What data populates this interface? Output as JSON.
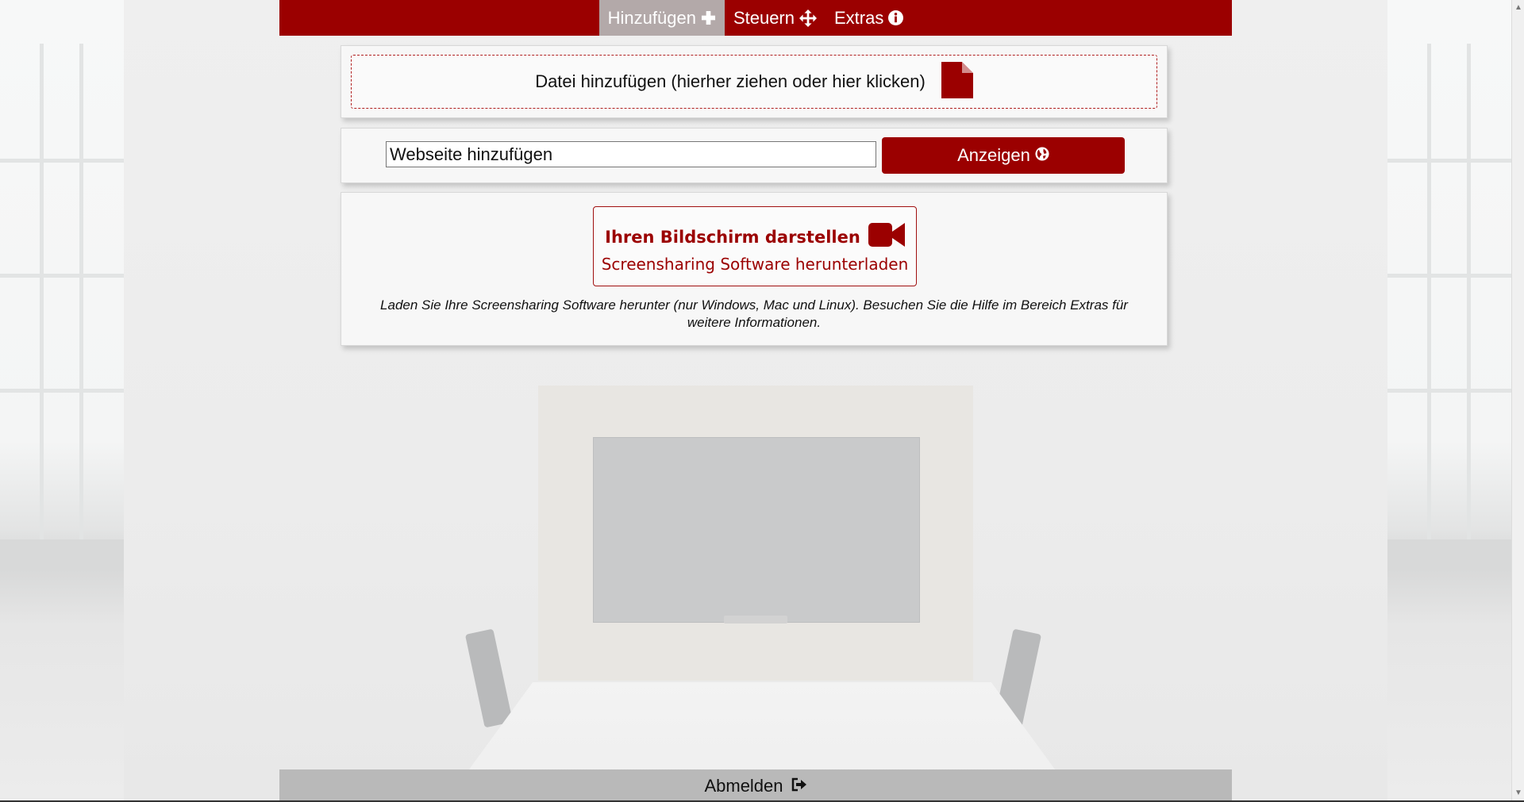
{
  "nav": {
    "items": [
      {
        "label": "Hinzufügen",
        "icon": "plus-icon",
        "active": true
      },
      {
        "label": "Steuern",
        "icon": "move-icon",
        "active": false
      },
      {
        "label": "Extras",
        "icon": "info-icon",
        "active": false
      }
    ]
  },
  "file_panel": {
    "label": "Datei hinzufügen (hierher ziehen oder hier klicken)",
    "icon": "file-icon"
  },
  "web_panel": {
    "input_value": "Webseite hinzufügen",
    "button_label": "Anzeigen",
    "button_icon": "globe-icon"
  },
  "screen_panel": {
    "title": "Ihren Bildschirm darstellen",
    "title_icon": "video-camera-icon",
    "link": "Screensharing Software herunterladen",
    "description": "Laden Sie Ihre Screensharing Software herunter (nur Windows, Mac und Linux). Besuchen Sie die Hilfe im Bereich Extras für weitere Informationen."
  },
  "footer": {
    "logout_label": "Abmelden",
    "logout_icon": "sign-out-icon"
  },
  "colors": {
    "brand": "#9b0000",
    "active_tab": "#b3a9a9",
    "footer_bg": "#b9b9b9",
    "panel_bg": "#f7f7f7"
  }
}
